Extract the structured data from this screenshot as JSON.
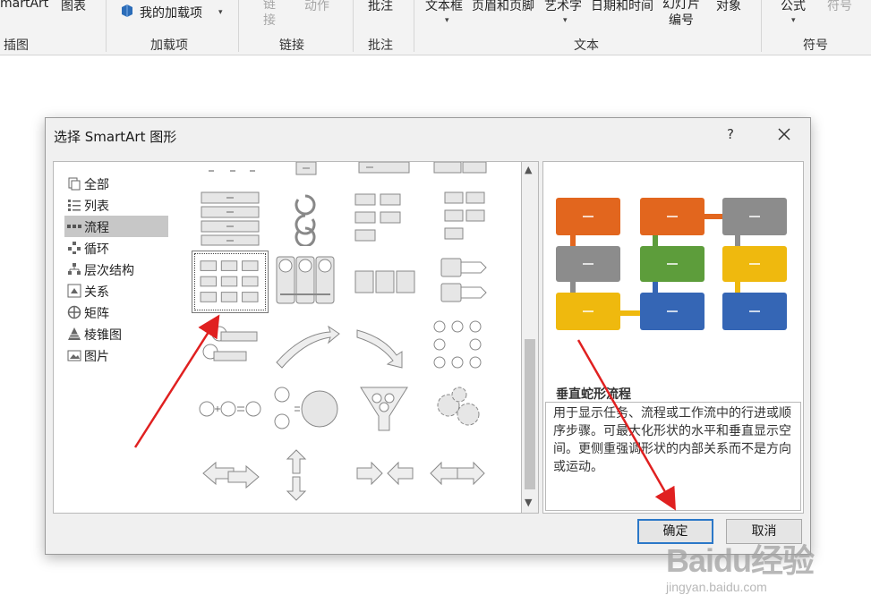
{
  "ribbon": {
    "left_cut_label": "martArt",
    "chart_label": "图表",
    "addins_label": "我的加载项",
    "link_label": "链\n接",
    "action_label": "动作",
    "comment_label": "批注",
    "textbox_label": "文本框",
    "header_footer_label": "页眉和页脚",
    "wordart_label": "艺术字",
    "datetime_label": "日期和时间",
    "slide_number_label": "幻灯片\n编号",
    "object_label": "对象",
    "equation_label": "公式",
    "symbol_label": "符号",
    "groups": {
      "illustrations": "插图",
      "addins": "加载项",
      "links": "链接",
      "comments": "批注",
      "text": "文本",
      "symbols": "符号"
    }
  },
  "dialog": {
    "title": "选择 SmartArt 图形",
    "help": "?",
    "categories": [
      {
        "label": "全部",
        "icon": "all-icon"
      },
      {
        "label": "列表",
        "icon": "list-icon"
      },
      {
        "label": "流程",
        "icon": "process-icon"
      },
      {
        "label": "循环",
        "icon": "cycle-icon"
      },
      {
        "label": "层次结构",
        "icon": "hierarchy-icon"
      },
      {
        "label": "关系",
        "icon": "relationship-icon"
      },
      {
        "label": "矩阵",
        "icon": "matrix-icon"
      },
      {
        "label": "棱锥图",
        "icon": "pyramid-icon"
      },
      {
        "label": "图片",
        "icon": "picture-icon"
      }
    ],
    "selected_category": "流程",
    "preview_name": "垂直蛇形流程",
    "preview_description": "用于显示任务、流程或工作流中的行进或顺序步骤。可最大化形状的水平和垂直显示空间。更侧重强调形状的内部关系而不是方向或运动。",
    "ok_label": "确定",
    "cancel_label": "取消",
    "colors": {
      "orange": "#e2661e",
      "gray": "#8c8c8c",
      "green": "#5d9d3b",
      "yellow": "#efb90e",
      "blue": "#3566b5"
    }
  },
  "watermark": {
    "brand": "Baidu经验",
    "url": "jingyan.baidu.com"
  }
}
